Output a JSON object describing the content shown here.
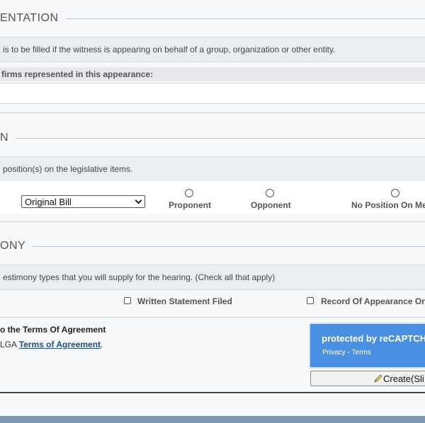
{
  "representation": {
    "section_title": "ENTATION",
    "note": "is to be filled if the witness is appearing on behalf of a group, organization or other entity.",
    "firms_label": "firms represented in this appearance:",
    "firms_value": ""
  },
  "position": {
    "section_title": "N",
    "note": "position(s) on the legislative items.",
    "bill_select": {
      "selected": "Original Bill"
    },
    "options": [
      "Proponent",
      "Opponent",
      "No Position On Me"
    ]
  },
  "testimony": {
    "section_title": "ONY",
    "note": "estimony types that you will supply for the hearing. (Check all that apply)",
    "options": [
      "Written Statement Filed",
      "Record Of Appearance On"
    ]
  },
  "terms": {
    "heading": "o the Terms Of Agreement",
    "prefix": "LGA ",
    "link_text": "Terms of Agreement",
    "suffix": "."
  },
  "recaptcha": {
    "title": "protected by reCAPTCHA",
    "privacy": "Privacy",
    "separator": " - ",
    "terms": "Terms"
  },
  "create_button": {
    "label": "Create(Sli"
  },
  "colors": {
    "recaptcha_blue": "#4a90e2",
    "link_blue": "#1d4e7d",
    "footer": "#7d97ae"
  },
  "icons": {
    "create_button": "pencil-icon",
    "select": "chevron-down-icon"
  }
}
